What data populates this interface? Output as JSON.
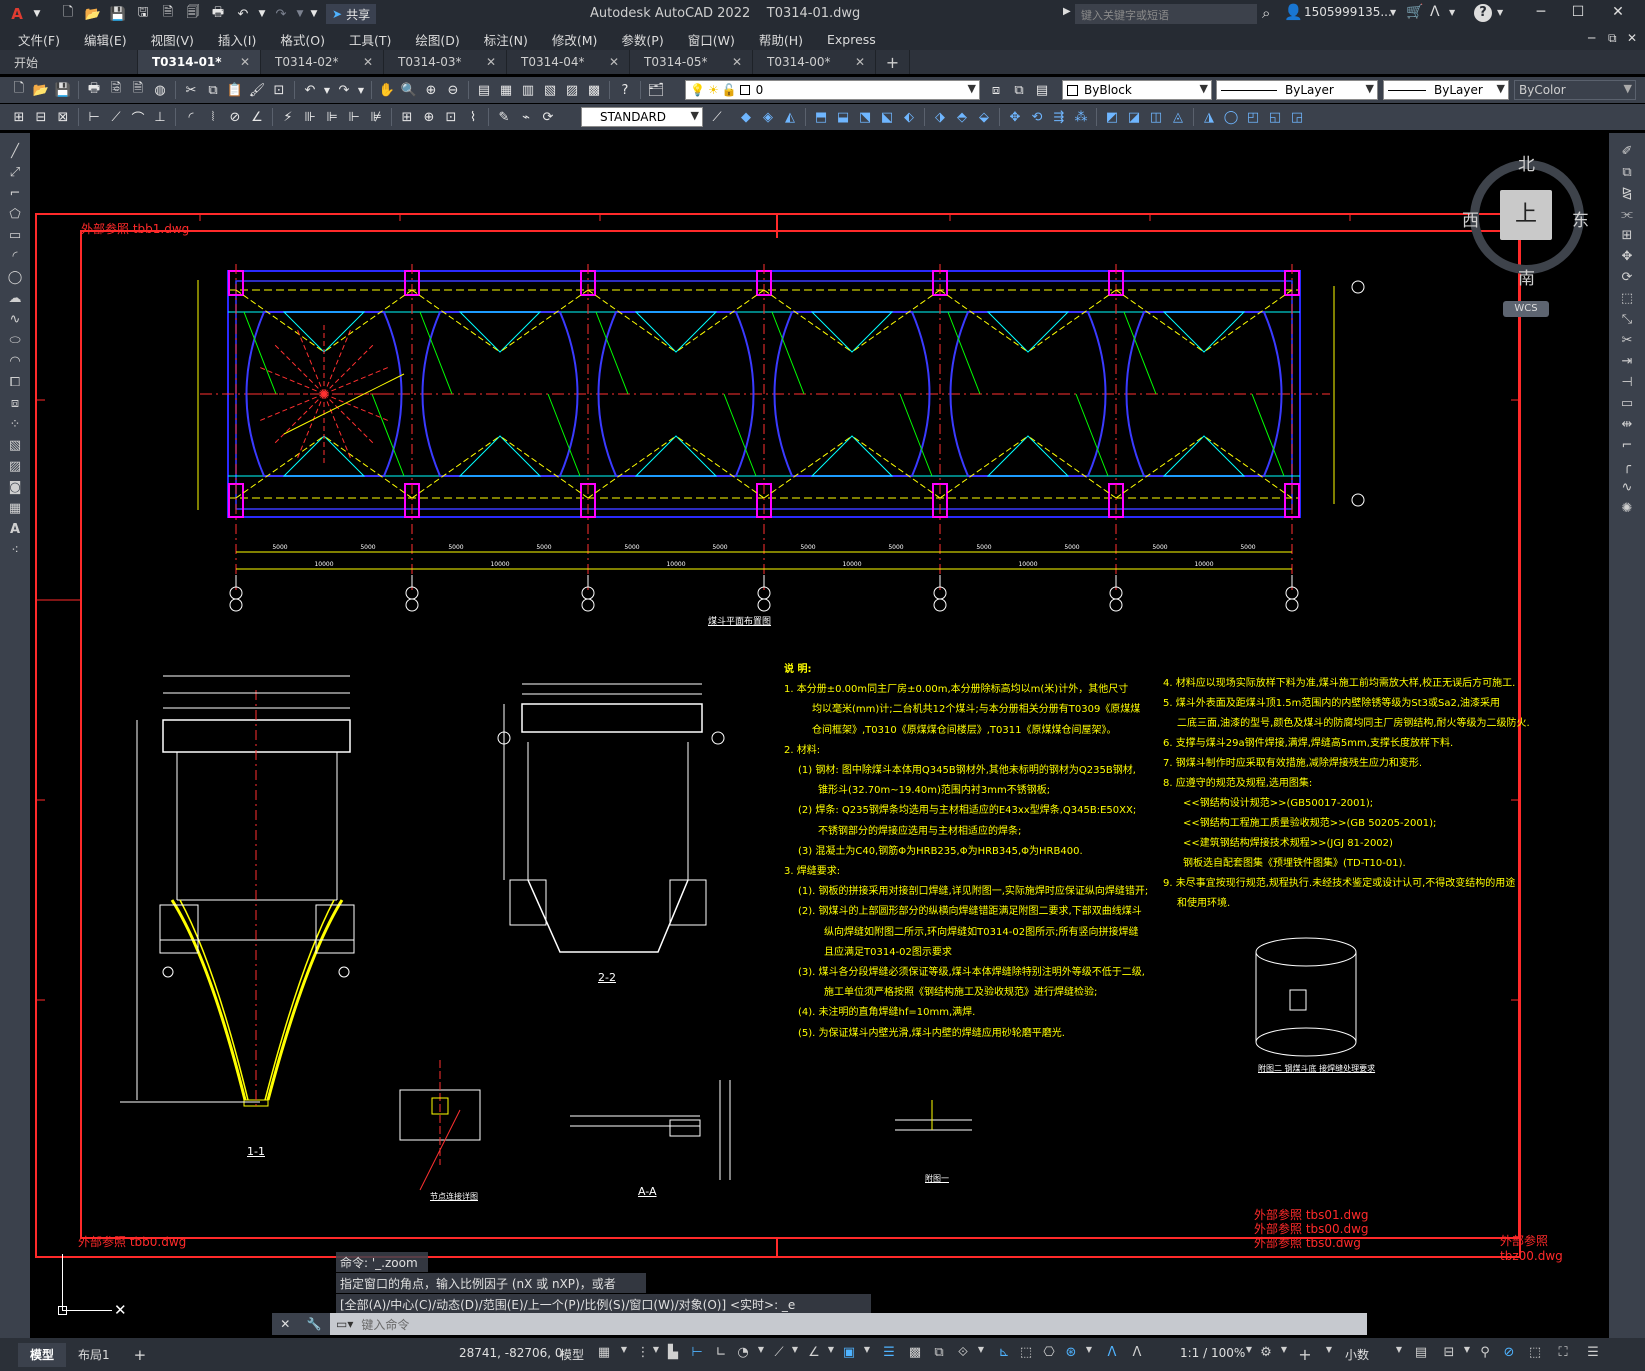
{
  "title_bar": {
    "title": "Autodesk AutoCAD 2022    T0314-01.dwg",
    "share_label": "共享",
    "search_placeholder": "键入关键字或短语",
    "user": "1505999135...",
    "help_icon": "help-icon"
  },
  "menu": [
    "文件(F)",
    "编辑(E)",
    "视图(V)",
    "插入(I)",
    "格式(O)",
    "工具(T)",
    "绘图(D)",
    "标注(N)",
    "修改(M)",
    "参数(P)",
    "窗口(W)",
    "帮助(H)",
    "Express"
  ],
  "tabs": [
    {
      "label": "开始",
      "active": false,
      "closable": false
    },
    {
      "label": "T0314-01*",
      "active": true,
      "closable": true
    },
    {
      "label": "T0314-02*",
      "active": false,
      "closable": true
    },
    {
      "label": "T0314-03*",
      "active": false,
      "closable": true
    },
    {
      "label": "T0314-04*",
      "active": false,
      "closable": true
    },
    {
      "label": "T0314-05*",
      "active": false,
      "closable": true
    },
    {
      "label": "T0314-00*",
      "active": false,
      "closable": true
    }
  ],
  "new_tab_label": "+",
  "toolbar_properties": {
    "layer": "0",
    "color": "ByBlock",
    "linetype": "ByLayer",
    "lineweight": "ByLayer",
    "plotstyle": "ByColor",
    "text_style": "STANDARD"
  },
  "viewcube": {
    "north": "北",
    "south": "南",
    "east": "东",
    "west": "西",
    "top": "上",
    "wcs": "WCS"
  },
  "drawing": {
    "xref_top_left": "外部参照 tbb1.dwg",
    "xref_bottom_left": "外部参照 tbb0.dwg",
    "xref_bottom_right_1": "外部参照 tbs01.dwg",
    "xref_bottom_right_2": "外部参照 tbs00.dwg",
    "xref_bottom_right_3": "外部参照 tbs0.dwg",
    "xref_bottom_right_4": "外部参照 tbz00.dwg",
    "plan_title": "煤斗平面布置图",
    "section_1": "1-1",
    "section_2": "2-2",
    "section_aa": "A-A",
    "detail_1": "节点连接详图",
    "detail_2": "附图一",
    "detail_3": "附图二  钢煤斗底 接焊缝处理要求",
    "notes_title": "说 明:",
    "notes_left": [
      "1. 本分册±0.00m同主厂房±0.00m,本分册除标高均以m(米)计外，其他尺寸",
      "均以毫米(mm)计;二台机共12个煤斗;与本分册相关分册有T0309《原煤煤",
      "仓间框架》,T0310《原煤煤仓间楼层》,T0311《原煤煤仓间屋架》。",
      "2. 材料:",
      "(1) 钢材: 图中除煤斗本体用Q345B钢材外,其他未标明的钢材为Q235B钢材,",
      "锥形斗(32.70m~19.40m)范围内衬3mm不锈钢板;",
      "(2) 焊条: Q235钢焊条均选用与主材相适应的E43xx型焊条,Q345B:E50XX;",
      "不锈钢部分的焊接应选用与主材相适应的焊条;",
      "(3) 混凝土为C40,钢筋Φ为HRB235,Φ为HRB345,Φ为HRB400.",
      "3. 焊缝要求:",
      "(1). 钢板的拼接采用对接剖口焊缝,详见附图一,实际施焊时应保证纵向焊缝错开;",
      "(2). 钢煤斗的上部圆形部分的纵横向焊缝错距满足附图二要求,下部双曲线煤斗",
      "纵向焊缝如附图二所示,环向焊缝如T0314-02图所示;所有竖向拼接焊缝",
      "且应满足T0314-02图示要求",
      "(3). 煤斗各分段焊缝必须保证等级,煤斗本体焊缝除特别注明外等级不低于二级,",
      "施工单位须严格按照《钢结构施工及验收规范》进行焊缝检验;",
      "(4). 未注明的直角焊缝hf=10mm,满焊.",
      "(5). 为保证煤斗内壁光滑,煤斗内壁的焊缝应用砂轮磨平磨光."
    ],
    "notes_right": [
      "4. 材料应以现场实际放样下料为准,煤斗施工前均需放大样,校正无误后方可施工.",
      "5. 煤斗外表面及距煤斗顶1.5m范围内的内壁除锈等级为St3或Sa2,油漆采用",
      "二底三面,油漆的型号,颜色及煤斗的防腐均同主厂房钢结构,耐火等级为二级防火.",
      "6. 支撑与煤斗29a钢件焊接,满焊,焊缝高5mm,支撑长度放样下料.",
      "7. 钢煤斗制作时应采取有效措施,减除焊接残生应力和变形.",
      "8. 应遵守的规范及规程,选用图集:",
      "<<钢结构设计规范>>(GB50017-2001);",
      "<<钢结构工程施工质量验收规范>>(GB 50205-2001);",
      "<<建筑钢结构焊接技术规程>>(JGJ 81-2002)",
      "钢板选自配套图集《预埋铁件图集》(TD-T10-01).",
      "9. 未尽事宜按现行规范,规程执行.未经技术鉴定或设计认可,不得改变结构的用途",
      "和使用环境."
    ],
    "axis_labels_bottom": [
      "⑧⑯",
      "⑦⑮",
      "⑥⑭",
      "⑤⑬",
      "④⑫",
      "③⑪",
      "②⑩"
    ],
    "axis_labels_right": [
      "Ⓓ",
      "Ⓒ"
    ],
    "dim_bottom_1": [
      "5000",
      "5000",
      "5000",
      "5000",
      "5000",
      "5000",
      "5000",
      "5000",
      "5000",
      "5000",
      "5000",
      "5000"
    ],
    "dim_bottom_2": [
      "10000",
      "10000",
      "10000",
      "10000",
      "10000",
      "10000"
    ]
  },
  "command": {
    "history": [
      "命令: '_.zoom",
      "指定窗口的角点，输入比例因子 (nX 或 nXP)，或者",
      "[全部(A)/中心(C)/动态(D)/范围(E)/上一个(P)/比例(S)/窗口(W)/对象(O)] <实时>: _e"
    ],
    "placeholder": "键入命令"
  },
  "status": {
    "layout_tabs": [
      "模型",
      "布局1"
    ],
    "add_label": "+",
    "coords": "28741, -82706, 0",
    "model_label": "模型",
    "scale": "1:1 / 100%",
    "units": "小数"
  }
}
